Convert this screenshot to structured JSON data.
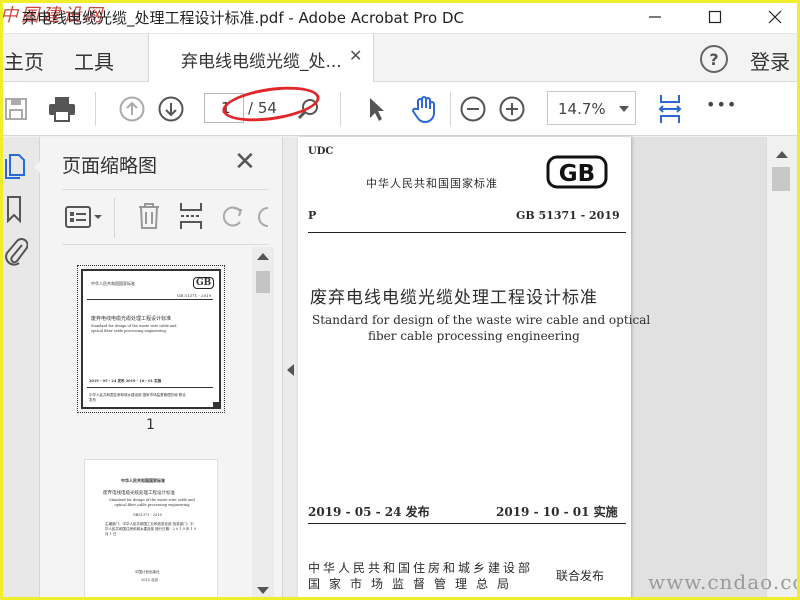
{
  "window": {
    "title": "弃电线电缆光缆_处理工程设计标准.pdf - Adobe Acrobat Pro DC",
    "watermark_logo": "中国建设网"
  },
  "menubar": {
    "home": "主页",
    "tools": "工具",
    "doc_tab": "弃电线电缆光缆_处...",
    "login": "登录",
    "help": "?"
  },
  "toolbar": {
    "current_page": "1",
    "total_pages": "/ 54",
    "zoom": "14.7%",
    "more": "•••"
  },
  "thumbnail_panel": {
    "title": "页面缩略图",
    "page_label": "1",
    "thumb1": {
      "header": "中华人民共和国国家标准",
      "gb": "GB",
      "std_no": "GB 51371 - 2019",
      "title": "废弃电线电缆光缆处理工程设计标准",
      "subtitle": "Standard for design of the waste wire cable and optical fiber cable processing engineering",
      "date": "2019 - 05 - 24 发布          2019 - 10 - 01 实施",
      "publisher": "中华人民共和国住房和城乡建设部 国家市场监督管理总局 联合发布"
    },
    "thumb2": {
      "header": "中华人民共和国国家标准",
      "title": "废弃电线电缆光缆处理工程设计标准",
      "subtitle": "Standard for design of the waste wire cable and optical fiber cable processing engineering",
      "std_no": "GB51371 - 2019",
      "lines": "主编部门：中华人民共和国工业和信息化部 批准部门：中华人民共和国住房和城乡建设部 施行日期：2 0 1 9 年 1 0 月 1 日",
      "press": "中国计划出版社",
      "city": "2019 北京"
    }
  },
  "document": {
    "udc": "UDC",
    "nat_std": "中华人民共和国国家标准",
    "gb_logo": "GB",
    "p": "P",
    "std_no": "GB 51371 - 2019",
    "title_cn": "废弃电线电缆光缆处理工程设计标准",
    "title_en_1": "Standard for design of the waste wire cable and optical",
    "title_en_2": "fiber cable processing engineering",
    "issue_date": "2019 - 05 - 24   发布",
    "effective_date": "2019 - 10 - 01   实施",
    "publisher_1": "中华人民共和国住房和城乡建设部",
    "publisher_2": "国家市场监督管理总局",
    "joint": "联合发布"
  },
  "site_watermark": "www.cndao.com",
  "colors": {
    "accent_blue": "#2a6ad3",
    "annotation_red": "#e0282c",
    "frame_yellow": "#f0ee2a"
  }
}
